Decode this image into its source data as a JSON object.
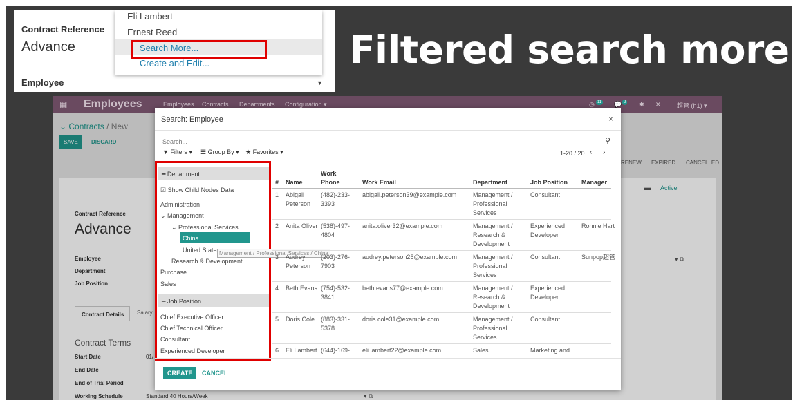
{
  "headline": "Filtered search more!",
  "banner": {
    "contract_ref_label": "Contract Reference",
    "contract_ref_value": "Advance",
    "employee_label": "Employee",
    "dropdown_items": [
      "Eli Lambert",
      "Ernest Reed"
    ],
    "search_more": "Search More...",
    "create_edit": "Create and Edit..."
  },
  "app": {
    "title": "Employees",
    "menus": [
      "Employees",
      "Contracts",
      "Departments",
      "Configuration ▾"
    ],
    "badges": [
      "11",
      "2"
    ],
    "user": "超管 (h1) ▾",
    "breadcrumb_root": "Contracts",
    "breadcrumb_sep": "/ New",
    "save": "SAVE",
    "discard": "DISCARD",
    "statuses": [
      "RENEW",
      "EXPIRED",
      "CANCELLED"
    ],
    "active": "Active",
    "form": {
      "contract_ref_label": "Contract Reference",
      "contract_ref_value": "Advance",
      "employee": "Employee",
      "department": "Department",
      "job_position": "Job Position",
      "tab_details": "Contract Details",
      "tab_salary": "Salary",
      "contract_terms": "Contract Terms",
      "start_date": "Start Date",
      "start_date_val": "01/",
      "end_date": "End Date",
      "end_trial": "End of Trial Period",
      "working_schedule": "Working Schedule",
      "working_schedule_val": "Standard 40 Hours/Week"
    }
  },
  "modal": {
    "title": "Search: Employee",
    "search_placeholder": "Search...",
    "filters": "Filters ▾",
    "group_by": "Group By ▾",
    "favorites": "Favorites ▾",
    "pager": "1-20 / 20",
    "side": {
      "department_header": "Department",
      "show_child": "Show Child Nodes Data",
      "departments": [
        "Administration",
        "Management",
        "Professional Services",
        "China",
        "United States",
        "Research & Development",
        "Purchase",
        "Sales"
      ],
      "tooltip": "Management / Professional Services / China",
      "job_header": "Job Position",
      "jobs": [
        "Chief Executive Officer",
        "Chief Technical Officer",
        "Consultant",
        "Experienced Developer"
      ]
    },
    "columns": [
      "#",
      "Name",
      "Work Phone",
      "Work Email",
      "Department",
      "Job Position",
      "Manager"
    ],
    "rows": [
      {
        "n": "1",
        "name": "Abigail Peterson",
        "phone": "(482)-233-3393",
        "email": "abigail.peterson39@example.com",
        "dept": "Management / Professional Services",
        "job": "Consultant",
        "mgr": ""
      },
      {
        "n": "2",
        "name": "Anita Oliver",
        "phone": "(538)-497-4804",
        "email": "anita.oliver32@example.com",
        "dept": "Management / Research & Development",
        "job": "Experienced Developer",
        "mgr": "Ronnie Hart"
      },
      {
        "n": "3",
        "name": "Audrey Peterson",
        "phone": "(203)-276-7903",
        "email": "audrey.peterson25@example.com",
        "dept": "Management / Professional Services",
        "job": "Consultant",
        "mgr": "Sunpop超管"
      },
      {
        "n": "4",
        "name": "Beth Evans",
        "phone": "(754)-532-3841",
        "email": "beth.evans77@example.com",
        "dept": "Management / Research & Development",
        "job": "Experienced Developer",
        "mgr": ""
      },
      {
        "n": "5",
        "name": "Doris Cole",
        "phone": "(883)-331-5378",
        "email": "doris.cole31@example.com",
        "dept": "Management / Professional Services",
        "job": "Consultant",
        "mgr": ""
      },
      {
        "n": "6",
        "name": "Eli Lambert",
        "phone": "(644)-169-",
        "email": "eli.lambert22@example.com",
        "dept": "Sales",
        "job": "Marketing and",
        "mgr": ""
      }
    ],
    "create": "CREATE",
    "cancel": "CANCEL"
  },
  "colors": {
    "brand": "#6a4a60",
    "accent": "#21968d",
    "highlight": "#e00000"
  }
}
